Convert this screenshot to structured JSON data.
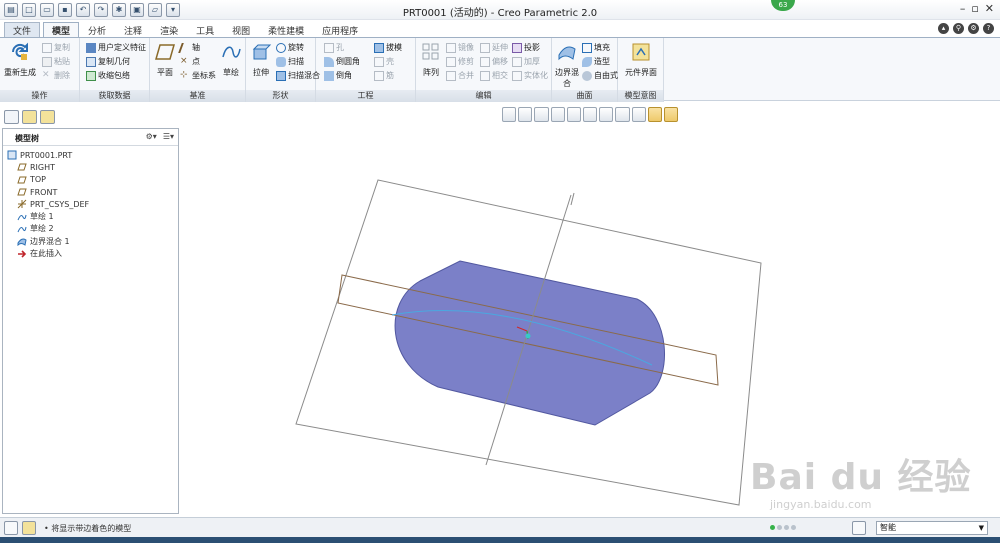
{
  "window": {
    "title": "PRT0001 (活动的) - Creo Parametric 2.0",
    "badge": "63"
  },
  "tabs": [
    "文件",
    "模型",
    "分析",
    "注释",
    "渲染",
    "工具",
    "视图",
    "柔性建模",
    "应用程序"
  ],
  "ribbon": {
    "operations": {
      "label": "操作",
      "regenerate": "重新生成",
      "copy": "复制",
      "paste": "粘贴",
      "delete": "删除"
    },
    "get_data": {
      "label": "获取数据",
      "udf": "用户定义特征",
      "copy_geom": "复制几何",
      "shrinkwrap": "收缩包络"
    },
    "datum": {
      "label": "基准",
      "plane": "平面",
      "axis": "轴",
      "point": "点",
      "csys": "坐标系",
      "sketch": "草绘"
    },
    "shapes": {
      "label": "形状",
      "extrude": "拉伸",
      "revolve": "旋转",
      "sweep": "扫描",
      "swept_blend": "扫描混合"
    },
    "engineering": {
      "label": "工程",
      "hole": "孔",
      "round": "倒圆角",
      "chamfer": "倒角",
      "draft": "拔模",
      "shell": "壳",
      "rib": "筋"
    },
    "editing": {
      "label": "编辑",
      "pattern": "阵列",
      "mirror": "镜像",
      "trim": "修剪",
      "merge": "合并",
      "extend": "延伸",
      "offset": "偏移",
      "intersect": "相交",
      "project": "投影",
      "thicken": "加厚",
      "solidify": "实体化"
    },
    "surfaces": {
      "label": "曲面",
      "boundary_blend": "边界混合",
      "fill": "填充",
      "style": "造型",
      "freestyle": "自由式"
    },
    "intent": {
      "label": "模型意图",
      "component_interface": "元件界面"
    }
  },
  "model_tree": {
    "title": "模型树",
    "items": [
      "PRT0001.PRT",
      "RIGHT",
      "TOP",
      "FRONT",
      "PRT_CSYS_DEF",
      "草绘 1",
      "草绘 2",
      "边界混合 1",
      "在此插入"
    ]
  },
  "status": {
    "message": "• 将显示带边着色的模型",
    "filter_value": "智能"
  },
  "watermark": {
    "logo": "Bai du 经验",
    "url": "jingyan.baidu.com"
  },
  "colors": {
    "surface_fill": "#7b80c8",
    "ribbon_bg": "#f6f8fb",
    "accent": "#36b24a"
  }
}
